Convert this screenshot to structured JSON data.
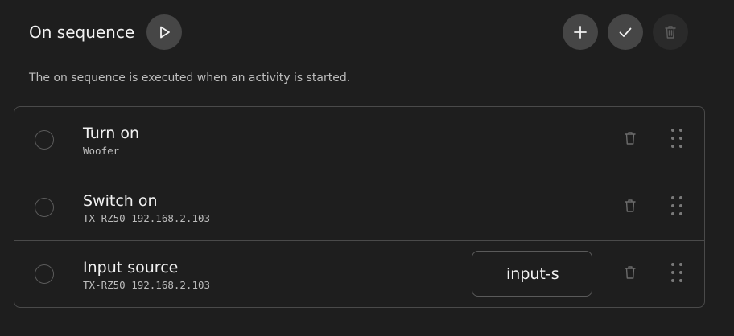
{
  "header": {
    "title": "On sequence",
    "play_icon": "play-icon",
    "actions": {
      "add_icon": "plus-icon",
      "confirm_icon": "check-icon",
      "delete_icon": "trash-icon"
    }
  },
  "description": "The on sequence is executed when an activity is started.",
  "items": [
    {
      "title": "Turn on",
      "subtitle": "Woofer"
    },
    {
      "title": "Switch on",
      "subtitle": "TX-RZ50 192.168.2.103"
    },
    {
      "title": "Input source",
      "subtitle": "TX-RZ50 192.168.2.103",
      "input_value": "input-s"
    }
  ],
  "colors": {
    "background": "#1e1e1e",
    "button": "#464646",
    "border": "#4a4a4a",
    "text": "#f2f2f2",
    "muted_text": "#bdbdbd"
  }
}
